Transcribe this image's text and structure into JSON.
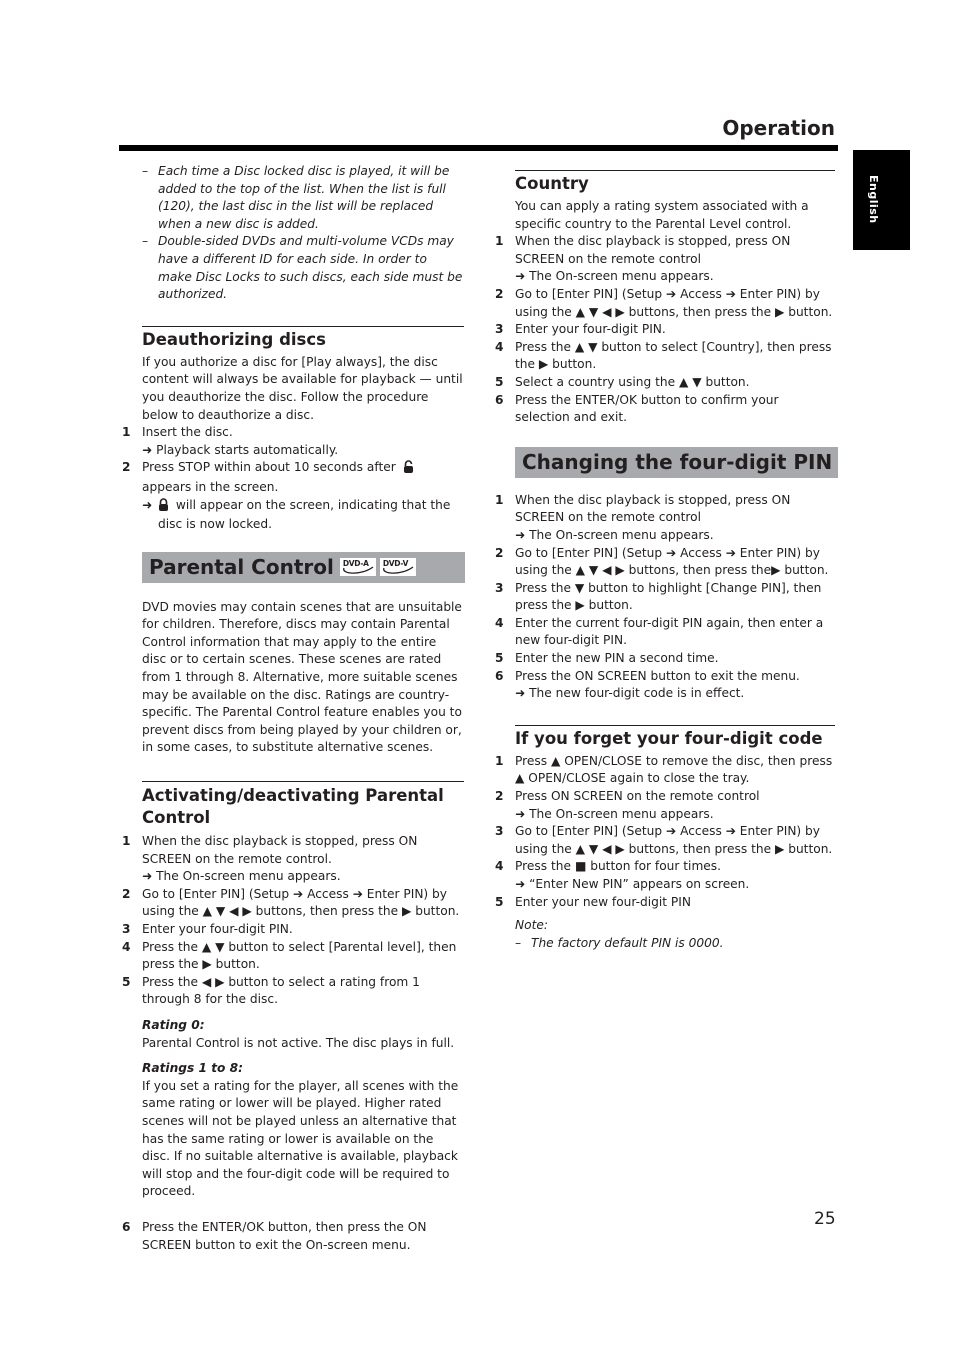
{
  "header": {
    "title": "Operation"
  },
  "language_tab": {
    "label": "English"
  },
  "page_number": "25",
  "left": {
    "intro_notes": [
      "Each time a Disc locked disc is played, it will be added to the top of the list. When the list is full (120), the last disc in the list will be replaced when a new disc is added.",
      "Double-sided DVDs and multi-volume VCDs may have a different ID for each side. In order to make Disc Locks to such discs, each side must be authorized."
    ],
    "deauthorizing": {
      "title": "Deauthorizing discs",
      "intro": "If you authorize a disc for [Play always], the disc content will always be available for playback — until you deauthorize the disc. Follow the procedure below to deauthorize a disc.",
      "steps": [
        {
          "num": "1",
          "text": "Insert the disc.",
          "result": "Playback starts automatically."
        },
        {
          "num": "2",
          "text_before_icon": "Press STOP within about 10 seconds after",
          "text_after_icon": "appears in the screen.",
          "icon": "unlocked-padlock-icon",
          "result_icon": "locked-padlock-icon",
          "result": "will appear on the screen, indicating that the disc is now locked."
        }
      ]
    },
    "parental_control": {
      "title": "Parental Control",
      "badges": [
        "DVD-A",
        "DVD-V"
      ],
      "intro": "DVD movies may contain scenes that are unsuitable for children. Therefore, discs may contain Parental Control information that may apply to the entire disc or to certain scenes. These scenes are rated from 1 through 8. Alternative, more suitable scenes may be available on the disc. Ratings are country-specific. The Parental Control feature enables you to prevent discs from being played by your children or, in some cases, to substitute alternative scenes."
    },
    "activating": {
      "title": "Activating/deactivating Parental Control",
      "steps": [
        {
          "num": "1",
          "text": "When the disc playback is stopped, press ON SCREEN on the remote control.",
          "result": "The On-screen menu appears."
        },
        {
          "num": "2",
          "text": "Go to [Enter PIN] (Setup ➔ Access ➔ Enter PIN) by using the ▲ ▼ ◀ ▶ buttons, then press the ▶ button."
        },
        {
          "num": "3",
          "text": "Enter your four-digit PIN."
        },
        {
          "num": "4",
          "text": "Press the ▲ ▼ button to select [Parental level], then press the ▶ button."
        },
        {
          "num": "5",
          "text": "Press the ◀ ▶ button to select a rating from 1 through 8 for the disc."
        }
      ],
      "rating0": {
        "label": "Rating 0:",
        "text": "Parental Control is not active. The disc plays in full."
      },
      "ratings1to8": {
        "label": "Ratings 1 to 8:",
        "text": "If you set a rating for the player, all scenes with the same rating or lower will be played. Higher rated scenes will not be played unless an alternative that has the same rating or lower is available on the disc. If no suitable alternative is available, playback will stop and the four-digit code will be required to proceed."
      },
      "step6": {
        "num": "6",
        "text": "Press the ENTER/OK button, then press the ON SCREEN button to exit the On-screen menu."
      }
    }
  },
  "right": {
    "country": {
      "title": "Country",
      "intro": "You can apply a rating system associated with a specific country to the Parental Level control.",
      "steps": [
        {
          "num": "1",
          "text": "When the disc playback is stopped, press ON SCREEN on the remote control",
          "result": "The On-screen menu appears."
        },
        {
          "num": "2",
          "text": "Go to [Enter PIN] (Setup ➔ Access ➔ Enter PIN) by using the ▲ ▼ ◀ ▶ buttons, then press the ▶ button."
        },
        {
          "num": "3",
          "text": "Enter your four-digit PIN."
        },
        {
          "num": "4",
          "text": "Press the ▲ ▼ button to select [Country], then press the ▶ button."
        },
        {
          "num": "5",
          "text": "Select a country using the ▲ ▼ button."
        },
        {
          "num": "6",
          "text": "Press the ENTER/OK button to confirm your selection and exit."
        }
      ]
    },
    "changing_pin": {
      "title": "Changing the four-digit PIN",
      "steps": [
        {
          "num": "1",
          "text": "When the disc playback is stopped, press ON SCREEN on the remote control",
          "result": "The On-screen menu appears."
        },
        {
          "num": "2",
          "text": "Go to [Enter PIN] (Setup ➔ Access ➔ Enter PIN) by using the ▲ ▼ ◀ ▶ buttons, then press the▶ button."
        },
        {
          "num": "3",
          "text": "Press the ▼ button to highlight [Change PIN], then press the ▶ button."
        },
        {
          "num": "4",
          "text": "Enter the current four-digit PIN again, then enter a new four-digit PIN."
        },
        {
          "num": "5",
          "text": "Enter the new PIN a second time."
        },
        {
          "num": "6",
          "text": "Press the ON SCREEN button to exit the menu.",
          "result": "The new four-digit code is in effect."
        }
      ]
    },
    "forget_code": {
      "title": "If you forget your four-digit code",
      "steps": [
        {
          "num": "1",
          "text": "Press ▲ OPEN/CLOSE to remove the disc, then press ▲ OPEN/CLOSE again to close the tray."
        },
        {
          "num": "2",
          "text": "Press ON SCREEN on the remote control",
          "result": "The On-screen menu appears."
        },
        {
          "num": "3",
          "text": "Go to [Enter PIN] (Setup ➔ Access ➔ Enter PIN) by using the ▲ ▼ ◀ ▶ buttons, then press the ▶ button."
        },
        {
          "num": "4",
          "text": "Press the ■ button for four times.",
          "result": "“Enter New PIN” appears on screen."
        },
        {
          "num": "5",
          "text": "Enter your new four-digit PIN"
        }
      ],
      "note_label": "Note:",
      "note": "The factory default PIN is 0000."
    }
  },
  "symbols": {
    "arrow": "➜",
    "dash": "–"
  }
}
